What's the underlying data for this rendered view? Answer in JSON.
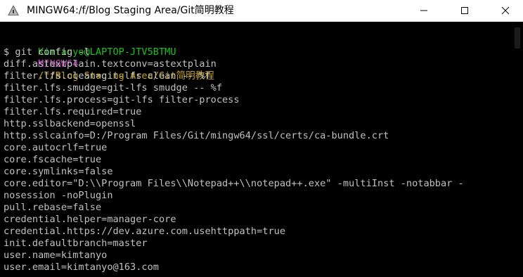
{
  "window": {
    "title": "MINGW64:/f/Blog Staging Area/Git简明教程",
    "icon": "mintty-icon",
    "controls": [
      "minimize-icon",
      "maximize-icon",
      "close-icon"
    ]
  },
  "prompt": {
    "user_host": "Kimtanyo@LAPTOP-JTV5BTMU",
    "env": "MINGW64",
    "path": "/f/Blog Staging Area/Git简明教程",
    "command": "$ git config -l"
  },
  "colors": {
    "user_host": "#1cc21c",
    "env": "#c242c2",
    "path": "#c1a01e",
    "text": "#c0c0c0",
    "background": "#000000"
  },
  "output": [
    "diff.astextplain.textconv=astextplain",
    "filter.lfs.clean=git-lfs clean -- %f",
    "filter.lfs.smudge=git-lfs smudge -- %f",
    "filter.lfs.process=git-lfs filter-process",
    "filter.lfs.required=true",
    "http.sslbackend=openssl",
    "http.sslcainfo=D:/Program Files/Git/mingw64/ssl/certs/ca-bundle.crt",
    "core.autocrlf=true",
    "core.fscache=true",
    "core.symlinks=false",
    "core.editor=\"D:\\\\Program Files\\\\Notepad++\\\\notepad++.exe\" -multiInst -notabbar -",
    "nosession -noPlugin",
    "pull.rebase=false",
    "credential.helper=manager-core",
    "credential.https://dev.azure.com.usehttppath=true",
    "init.defaultbranch=master",
    "user.name=kimtanyo",
    "user.email=kimtanyo@163.com"
  ]
}
